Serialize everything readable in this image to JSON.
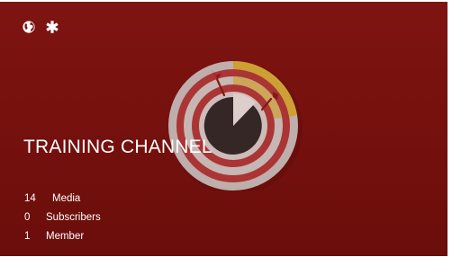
{
  "channel": {
    "title": "TRAINING CHANNEL",
    "background_color": "#7a1310"
  },
  "icons": {
    "globe": "globe-icon",
    "asterisk": "asterisk-icon"
  },
  "stats": [
    {
      "count": "14",
      "label": "Media"
    },
    {
      "count": "0",
      "label": "Subscribers"
    },
    {
      "count": "1",
      "label": "Member"
    }
  ]
}
